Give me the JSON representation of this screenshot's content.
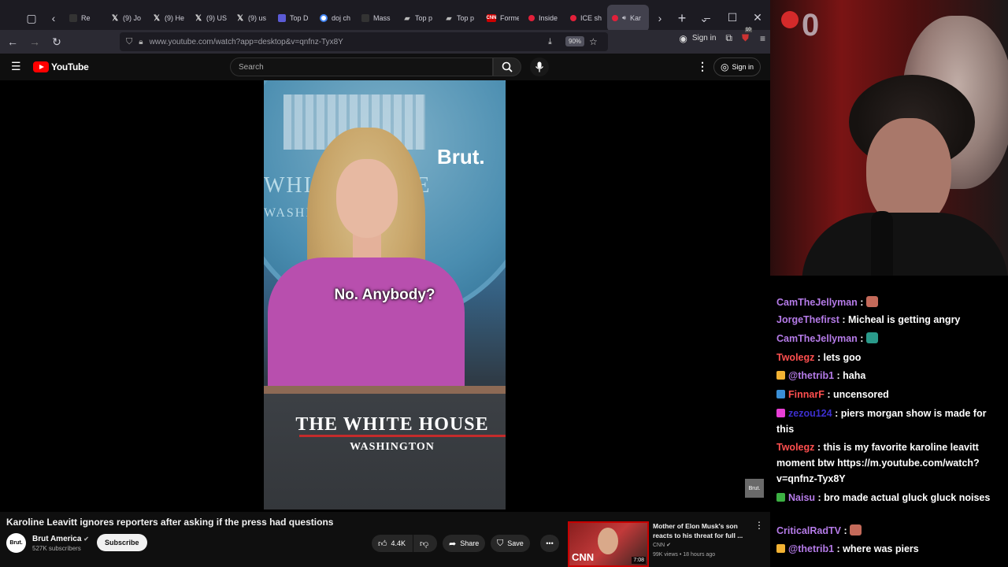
{
  "browser": {
    "tabs": [
      {
        "label": "Re",
        "icon": "reddit"
      },
      {
        "label": "(9) Jo",
        "icon": "x"
      },
      {
        "label": "(9) He",
        "icon": "x"
      },
      {
        "label": "(9) US",
        "icon": "x"
      },
      {
        "label": "(9) us",
        "icon": "x"
      },
      {
        "label": "Top D",
        "icon": "channel"
      },
      {
        "label": "doj ch",
        "icon": "google"
      },
      {
        "label": "Mass",
        "icon": "none"
      },
      {
        "label": "Top p",
        "icon": "twitch"
      },
      {
        "label": "Top p",
        "icon": "twitch"
      },
      {
        "label": "Forme",
        "icon": "cnn"
      },
      {
        "label": "Inside",
        "icon": "youtube"
      },
      {
        "label": "ICE sh",
        "icon": "youtube"
      },
      {
        "label": "Kar",
        "icon": "youtube"
      }
    ],
    "url": "www.youtube.com/watch?app=desktop&v=qnfnz-Tyx8Y",
    "zoom": "90%",
    "toolbar_signin": "Sign in",
    "extension_badge": "10"
  },
  "youtube": {
    "logo_text": "YouTube",
    "search_placeholder": "Search",
    "signin_label": "Sign in",
    "video": {
      "brand_logo": "Brut.",
      "seal_text_1": "WHITE HOUSE",
      "seal_text_2": "WASHINGTON",
      "caption": "No. Anybody?",
      "podium_text_1": "THE WHITE HOUSE",
      "podium_text_2": "WASHINGTON",
      "watermark": "Brut."
    },
    "title": "Karoline Leavitt ignores reporters after asking if the press had questions",
    "channel": {
      "avatar_text": "Brut.",
      "name": "Brut America",
      "subscribers": "527K subscribers",
      "subscribe_label": "Subscribe"
    },
    "actions": {
      "likes": "4.4K",
      "share_label": "Share",
      "save_label": "Save"
    },
    "recommended": {
      "title": "Mother of Elon Musk's son reacts to his threat for full ...",
      "channel": "CNN",
      "meta": "99K views • 18 hours ago",
      "duration": "7:08",
      "thumb_logo": "CNN"
    }
  },
  "stream": {
    "overlay_number": "0",
    "chat": [
      {
        "user": "CamTheJellyman",
        "color": "#b57be8",
        "message": "",
        "emote": true,
        "badge": ""
      },
      {
        "user": "JorgeThefirst",
        "color": "#b57be8",
        "message": "Micheal is getting angry",
        "emote": false,
        "badge": ""
      },
      {
        "user": "CamTheJellyman",
        "color": "#b57be8",
        "message": "",
        "emote": true,
        "badge": ""
      },
      {
        "user": "Twolegz",
        "color": "#ff4f4f",
        "message": "lets goo",
        "emote": false,
        "badge": ""
      },
      {
        "user": "@thetrib1",
        "color": "#b57be8",
        "message": "haha",
        "emote": false,
        "badge": "#f2b233"
      },
      {
        "user": "FinnarF",
        "color": "#ff4f4f",
        "message": "uncensored",
        "emote": false,
        "badge": "#3a8fd6"
      },
      {
        "user": "zezou124",
        "color": "#3d2fd0",
        "message": "piers morgan show is made for this",
        "emote": false,
        "badge": "#e83fd6"
      },
      {
        "user": "Twolegz",
        "color": "#ff4f4f",
        "message": "this is my favorite karoline leavitt moment btw https://m.youtube.com/watch?v=qnfnz-Tyx8Y",
        "emote": false,
        "badge": ""
      },
      {
        "user": "Naisu",
        "color": "#b57be8",
        "message": "bro made actual gluck gluck noises",
        "emote": false,
        "badge": "#3cb043"
      },
      {
        "user": "CriticalRadTV",
        "color": "#b57be8",
        "message": "",
        "emote": true,
        "badge": ""
      },
      {
        "user": "@thetrib1",
        "color": "#b57be8",
        "message": "where was piers",
        "emote": false,
        "badge": "#f2b233"
      }
    ]
  }
}
